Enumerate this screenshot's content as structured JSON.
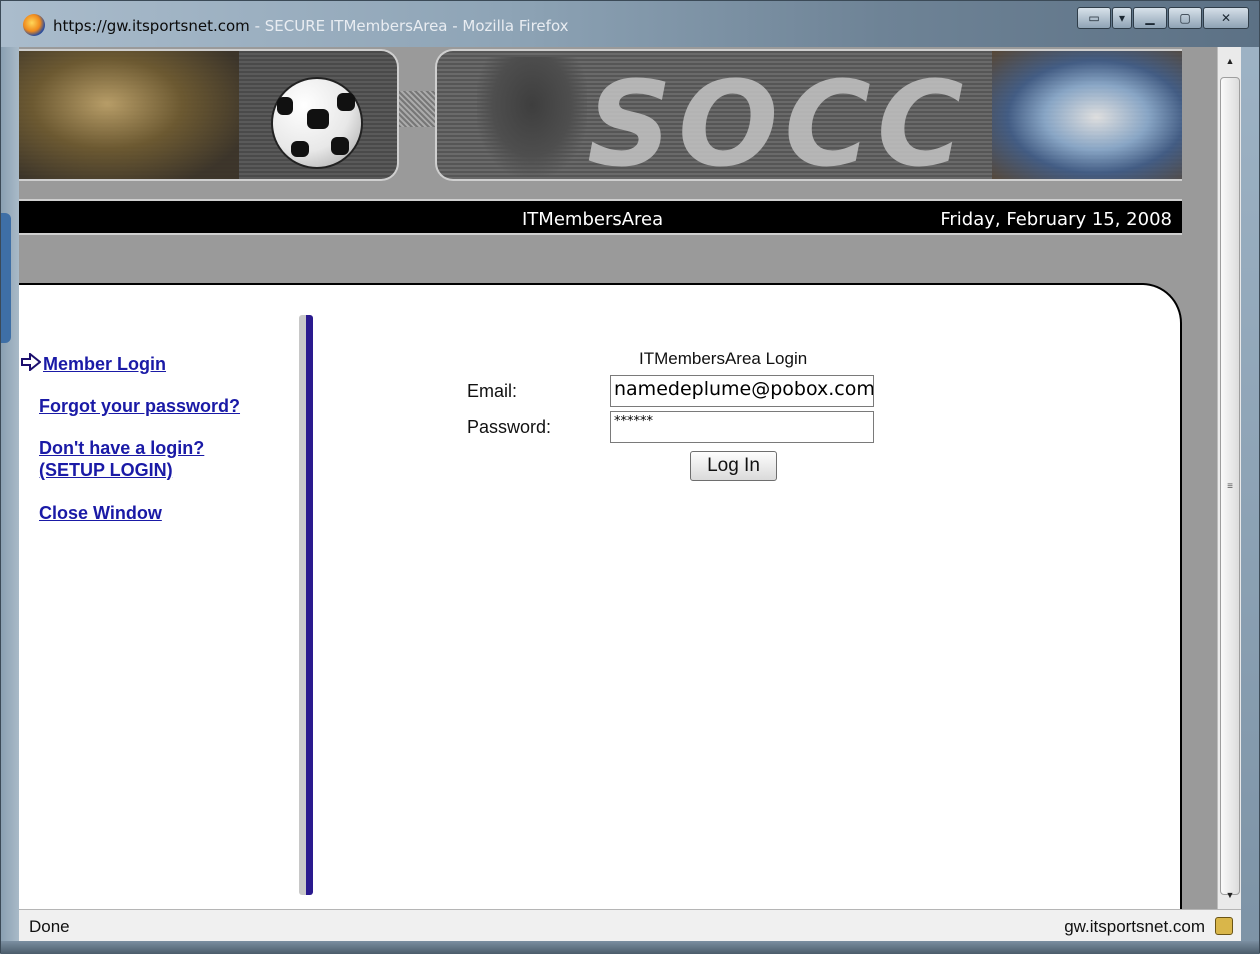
{
  "window": {
    "title_url": "https://gw.itsportsnet.com",
    "title_rest": " - SECURE ITMembersArea - Mozilla Firefox"
  },
  "banner": {
    "word": "SOCC"
  },
  "infobar": {
    "site_name": "ITMembersArea",
    "date": "Friday, February 15, 2008"
  },
  "sidebar": {
    "links": [
      {
        "label": "Member Login"
      },
      {
        "label": "Forgot your password?"
      },
      {
        "label": "Don't have a login?"
      },
      {
        "label": "(SETUP LOGIN)"
      },
      {
        "label": "Close Window"
      }
    ]
  },
  "login": {
    "title": "ITMembersArea Login",
    "email_label": "Email:",
    "email_value": "namedeplume@pobox.com",
    "password_label": "Password:",
    "password_value": "******",
    "button": "Log In"
  },
  "statusbar": {
    "status": "Done",
    "host": "gw.itsportsnet.com"
  },
  "icons": {
    "browser": "firefox-icon",
    "active_link": "arrow-right-icon",
    "security": "lock-icon"
  },
  "colors": {
    "link": "#1a1aa6",
    "divider": "#2a1a8e",
    "infobar": "#000000"
  }
}
